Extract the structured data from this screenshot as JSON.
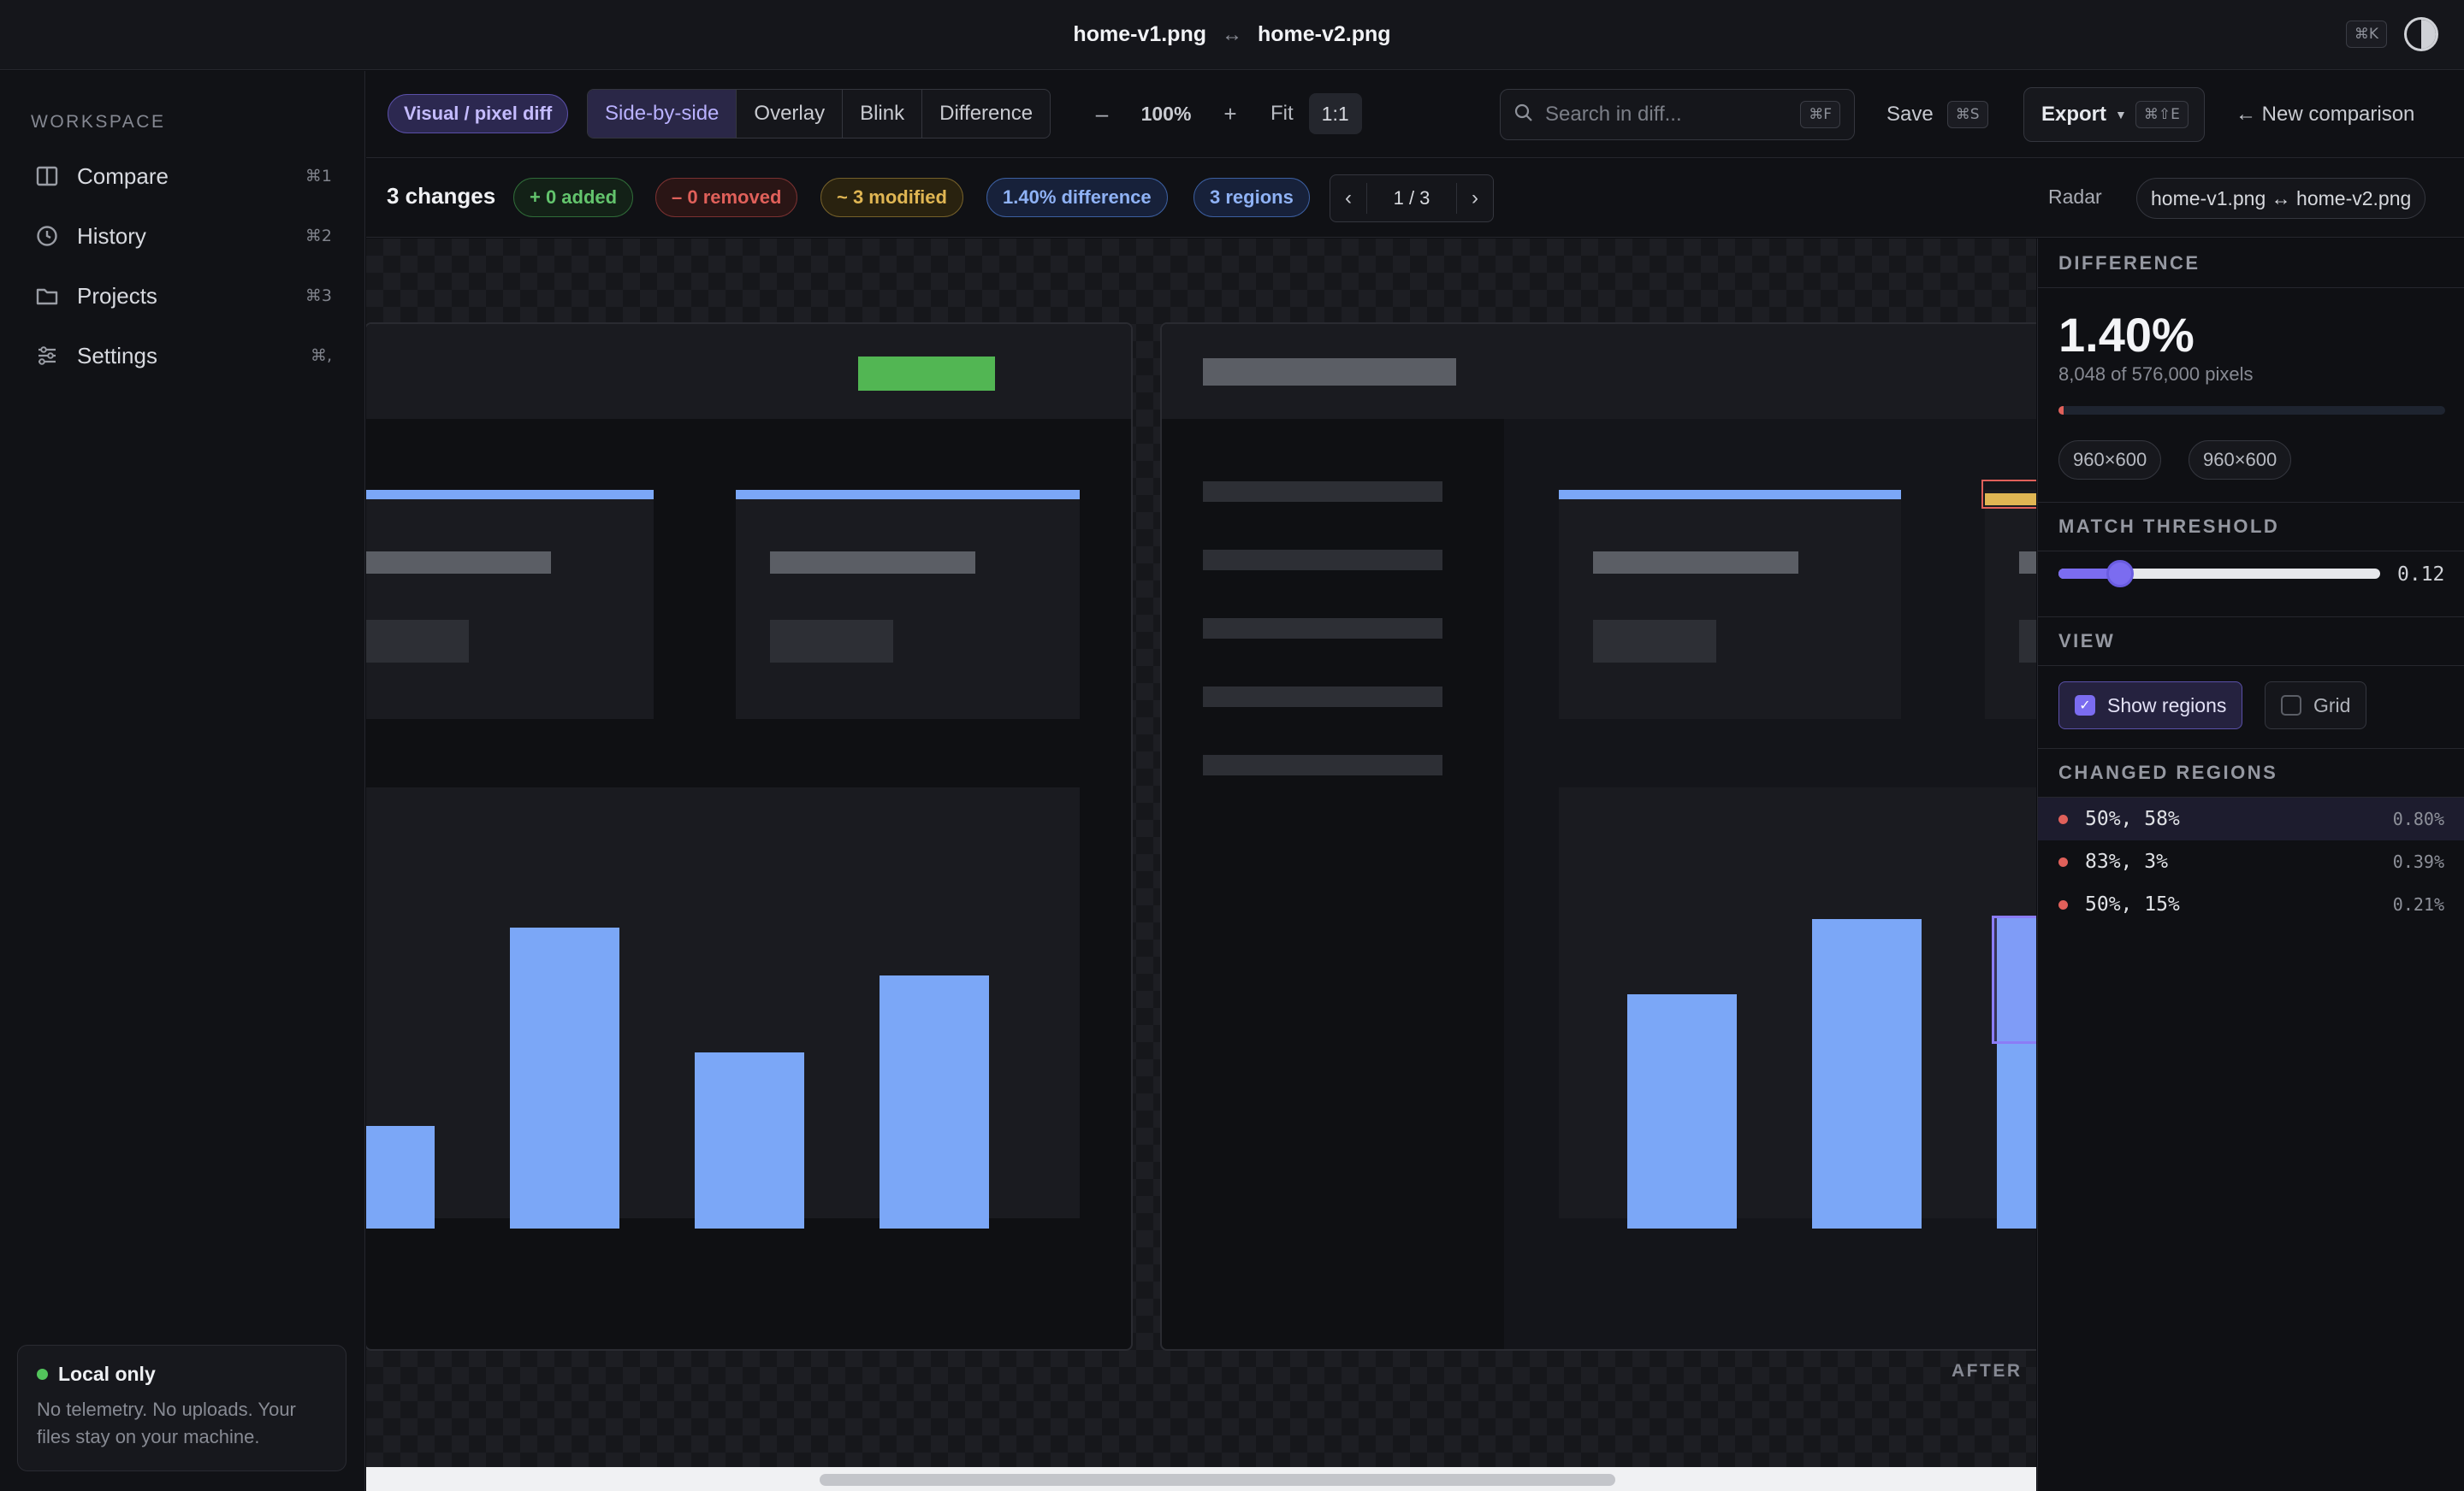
{
  "titlebar": {
    "file_a": "home-v1.png",
    "swap_symbol": "↔",
    "file_b": "home-v2.png",
    "shortcut": "⌘K"
  },
  "sidebar": {
    "section_label": "WORKSPACE",
    "items": [
      {
        "label": "Compare",
        "shortcut": "⌘1",
        "icon": "columns-icon"
      },
      {
        "label": "History",
        "shortcut": "⌘2",
        "icon": "clock-icon"
      },
      {
        "label": "Projects",
        "shortcut": "⌘3",
        "icon": "folder-icon"
      },
      {
        "label": "Settings",
        "shortcut": "⌘,",
        "icon": "sliders-icon"
      }
    ],
    "local_card": {
      "title": "Local only",
      "description": "No telemetry. No uploads. Your files stay on your machine."
    }
  },
  "toolbar": {
    "mode_label": "Visual / pixel diff",
    "view_modes": [
      "Side-by-side",
      "Overlay",
      "Blink",
      "Difference"
    ],
    "active_view_mode": "Side-by-side",
    "zoom_out": "–",
    "zoom_value": "100%",
    "zoom_in": "+",
    "fit_label": "Fit",
    "actual_size_label": "1:1",
    "search_placeholder": "Search in diff...",
    "search_shortcut": "⌘F",
    "save_label": "Save",
    "save_shortcut": "⌘S",
    "export_label": "Export",
    "export_shortcut": "⌘⇧E",
    "new_comparison_label": "← New comparison"
  },
  "stats": {
    "changes_label": "3 changes",
    "added": "+ 0 added",
    "removed": "– 0 removed",
    "modified": "~ 3 modified",
    "difference": "1.40% difference",
    "regions": "3 regions",
    "pager_prev": "‹",
    "pager_value": "1 / 3",
    "pager_next": "›",
    "radar_label": "Radar",
    "file_pair": "home-v1.png ↔ home-v2.png"
  },
  "canvas": {
    "after_label": "AFTER",
    "scroll_fraction": 0.05,
    "colors": {
      "accent_bar": "#7ba7f7",
      "chart_bar": "#7ba7f7",
      "added_block": "#52b653",
      "modified_outline": "#8b7cf6"
    }
  },
  "inspector": {
    "difference_heading": "DIFFERENCE",
    "difference_pct": "1.40%",
    "pixel_summary": "8,048 of 576,000 pixels",
    "difference_fraction": 0.014,
    "dim_a": "960×600",
    "dim_b": "960×600",
    "threshold_heading": "MATCH THRESHOLD",
    "threshold_value": "0.12",
    "threshold_fraction": 0.12,
    "view_heading": "VIEW",
    "show_regions_label": "Show regions",
    "show_regions_checked": true,
    "grid_label": "Grid",
    "grid_checked": false,
    "regions_heading": "CHANGED REGIONS",
    "regions": [
      {
        "name": "50%, 58%",
        "value": "0.80%",
        "selected": true
      },
      {
        "name": "83%, 3%",
        "value": "0.39%",
        "selected": false
      },
      {
        "name": "50%, 15%",
        "value": "0.21%",
        "selected": false
      }
    ]
  }
}
